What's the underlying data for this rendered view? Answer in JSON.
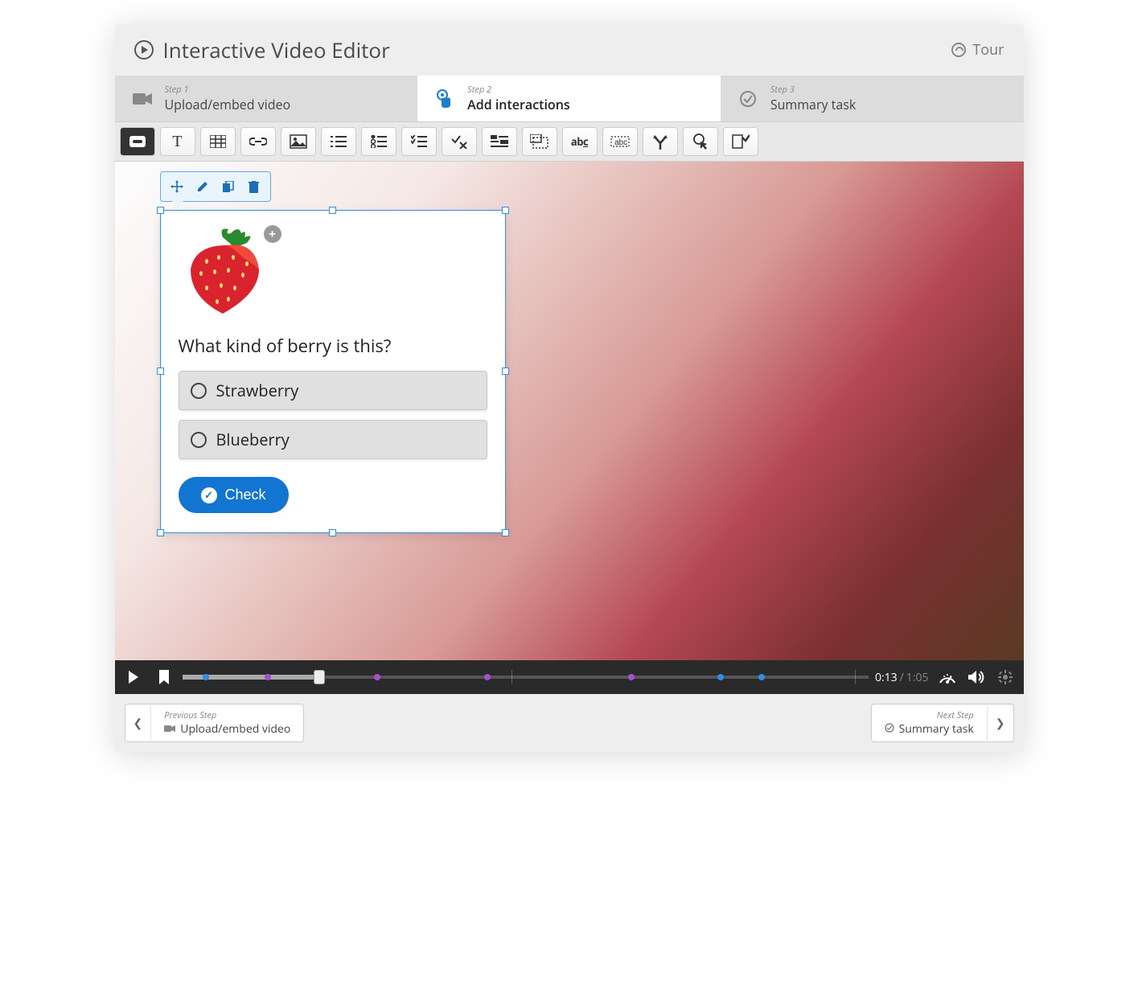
{
  "header": {
    "title": "Interactive Video Editor",
    "tour_label": "Tour"
  },
  "steps": [
    {
      "label": "Step 1",
      "name": "Upload/embed video",
      "active": false
    },
    {
      "label": "Step 2",
      "name": "Add interactions",
      "active": true
    },
    {
      "label": "Step 3",
      "name": "Summary task",
      "active": false
    }
  ],
  "toolbar": [
    "label-button",
    "text",
    "table",
    "link",
    "image",
    "list-ul",
    "list-ol",
    "checklist",
    "percent",
    "branching",
    "frame",
    "word",
    "word-box",
    "crossroads",
    "touch",
    "checkmark-box"
  ],
  "context_toolbar": [
    "move",
    "edit",
    "copy",
    "delete"
  ],
  "interaction": {
    "question": "What kind of berry is this?",
    "options": [
      "Strawberry",
      "Blueberry"
    ],
    "check_label": "Check",
    "add_symbol": "+"
  },
  "playbar": {
    "current": "0:13",
    "duration": "1:05",
    "separator": "/",
    "progress_pct": 20,
    "markers": [
      {
        "pos_pct": 3,
        "color": "blue"
      },
      {
        "pos_pct": 12,
        "color": "purple"
      },
      {
        "pos_pct": 28,
        "color": "purple"
      },
      {
        "pos_pct": 44,
        "color": "purple"
      },
      {
        "pos_pct": 65,
        "color": "purple"
      },
      {
        "pos_pct": 78,
        "color": "blue"
      },
      {
        "pos_pct": 84,
        "color": "blue"
      }
    ],
    "ticks_pct": [
      48,
      98
    ]
  },
  "footer": {
    "prev": {
      "label": "Previous Step",
      "name": "Upload/embed video"
    },
    "next": {
      "label": "Next Step",
      "name": "Summary task"
    }
  }
}
